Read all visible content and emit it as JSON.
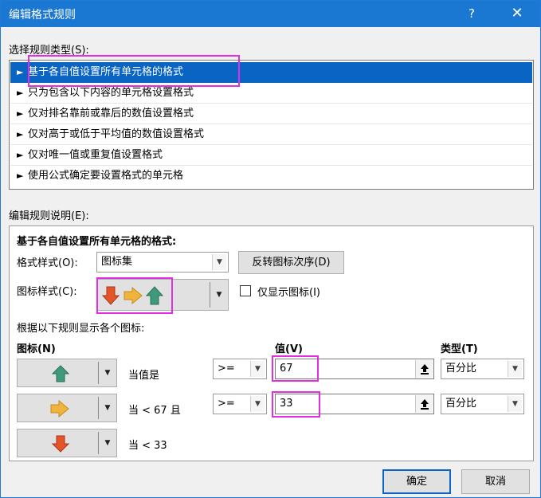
{
  "window": {
    "title": "编辑格式规则",
    "help_glyph": "?",
    "close_glyph": "✕"
  },
  "rule_type": {
    "label": "选择规则类型(S):",
    "items": [
      "基于各自值设置所有单元格的格式",
      "只为包含以下内容的单元格设置格式",
      "仅对排名靠前或靠后的数值设置格式",
      "仅对高于或低于平均值的数值设置格式",
      "仅对唯一值或重复值设置格式",
      "使用公式确定要设置格式的单元格"
    ],
    "selected_index": 0,
    "bullet": "►"
  },
  "rule_desc": {
    "label": "编辑规则说明(E):",
    "heading": "基于各自值设置所有单元格的格式:",
    "format_style_label": "格式样式(O):",
    "format_style_value": "图标集",
    "reverse_button": "反转图标次序(D)",
    "icon_style_label": "图标样式(C):",
    "show_icon_only_label": "仅显示图标(I)",
    "show_icon_only_checked": false,
    "rules_label": "根据以下规则显示各个图标:",
    "col_icon": "图标(N)",
    "col_value": "值(V)",
    "col_type": "类型(T)",
    "rows": [
      {
        "icon": "green-up-arrow-icon",
        "condition": "当值是",
        "operator": ">=",
        "value": "67",
        "type": "百分比"
      },
      {
        "icon": "yellow-right-arrow-icon",
        "condition": "当 < 67 且",
        "operator": ">=",
        "value": "33",
        "type": "百分比"
      },
      {
        "icon": "red-down-arrow-icon",
        "condition": "当 < 33"
      }
    ]
  },
  "buttons": {
    "ok": "确定",
    "cancel": "取消"
  },
  "colors": {
    "accent": "#1a78d3",
    "selection": "#0a64c4",
    "highlight": "#e02ee0",
    "arrow_green": "#3f9a7b",
    "arrow_yellow": "#f0b43c",
    "arrow_red": "#e2562a"
  }
}
